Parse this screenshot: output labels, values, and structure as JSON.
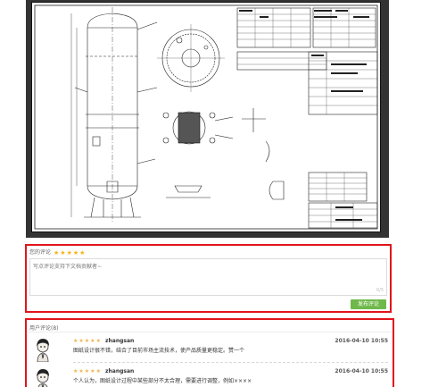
{
  "preview": {
    "alt": "engineering drawing preview"
  },
  "comment_form": {
    "title": "您的评论",
    "rating_stars": 5,
    "placeholder": "写点评论支持下文档贡献者~",
    "counter": "0/5",
    "submit_label": "发布评论"
  },
  "comments": {
    "title": "用户评论(8)",
    "items": [
      {
        "stars": 5,
        "user": "zhangsan",
        "date": "2016-04-10 10:55",
        "text": "图纸设计很不错，结合了目前市场主流技术，使产品质量更稳定。赞一个"
      },
      {
        "stars": 5,
        "user": "zhangsan",
        "date": "2016-04-10 10:55",
        "text": "个人认为，图纸设计过程中某些部分不太合理，需要进行调整，例如××××"
      }
    ]
  },
  "colors": {
    "highlight_border": "#e0151c",
    "submit_bg": "#6fb94a",
    "star": "#f5b318"
  }
}
